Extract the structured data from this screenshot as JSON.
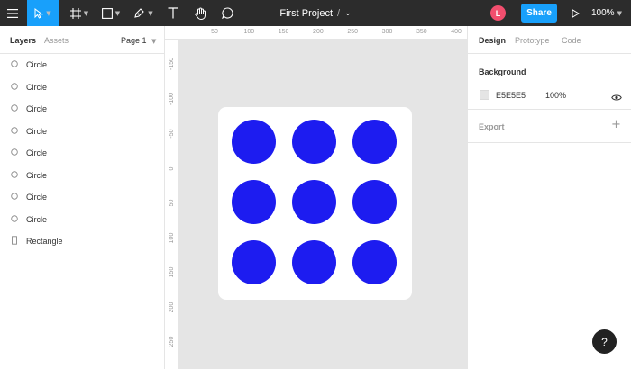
{
  "app": {
    "title": "First Project",
    "title_separator": "/",
    "title_menu": "⌄",
    "zoom": "100%"
  },
  "toolbar": {
    "user_initial": "L",
    "share_label": "Share",
    "accent": "#18a0fb"
  },
  "left_panel": {
    "tabs": [
      "Layers",
      "Assets"
    ],
    "page": "Page 1",
    "layers": [
      {
        "name": "Circle",
        "icon": "circle-icon"
      },
      {
        "name": "Circle",
        "icon": "circle-icon"
      },
      {
        "name": "Circle",
        "icon": "circle-icon"
      },
      {
        "name": "Circle",
        "icon": "circle-icon"
      },
      {
        "name": "Circle",
        "icon": "circle-icon"
      },
      {
        "name": "Circle",
        "icon": "circle-icon"
      },
      {
        "name": "Circle",
        "icon": "circle-icon"
      },
      {
        "name": "Circle",
        "icon": "circle-icon"
      },
      {
        "name": "Rectangle",
        "icon": "rectangle-icon"
      }
    ]
  },
  "rulers": {
    "top": [
      "50",
      "100",
      "150",
      "200",
      "250",
      "300",
      "350",
      "400"
    ],
    "left": [
      "-150",
      "-100",
      "-50",
      "0",
      "50",
      "100",
      "150",
      "200",
      "250"
    ]
  },
  "canvas": {
    "background": "#E5E5E5",
    "frame_color": "#FFFFFF",
    "circle_color": "#1d1cf0",
    "circle_count": 9
  },
  "right_panel": {
    "tabs": [
      "Design",
      "Prototype",
      "Code"
    ],
    "background_section": {
      "title": "Background",
      "hex": "E5E5E5",
      "opacity": "100%"
    },
    "export_section": {
      "title": "Export",
      "add": "+"
    }
  },
  "help": {
    "label": "?"
  }
}
